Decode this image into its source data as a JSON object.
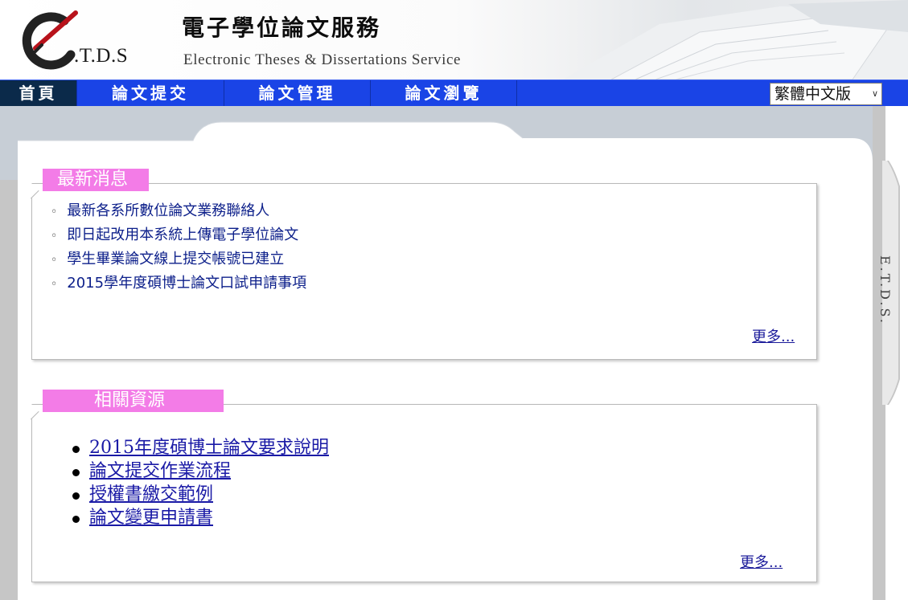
{
  "header": {
    "logo_text": ".T.D.S",
    "title_zh": "電子學位論文服務",
    "title_en": "Electronic Theses & Dissertations Service"
  },
  "nav": {
    "items": [
      {
        "label": "首頁"
      },
      {
        "label": "論文提交"
      },
      {
        "label": "論文管理"
      },
      {
        "label": "論文瀏覽"
      }
    ],
    "language_selected": "繁體中文版"
  },
  "side_tab": {
    "label": "E.T.D.S."
  },
  "news": {
    "heading": "最新消息",
    "items": [
      "最新各系所數位論文業務聯絡人",
      "即日起改用本系統上傳電子學位論文",
      "學生畢業論文線上提交帳號已建立",
      "2015學年度碩博士論文口試申請事項"
    ],
    "more": "更多..."
  },
  "resources": {
    "heading": "相關資源",
    "items": [
      "2015年度碩博士論文要求說明",
      "論文提交作業流程",
      "授權書繳交範例",
      "論文變更申請書"
    ],
    "more": "更多..."
  },
  "colors": {
    "nav_bg": "#1a44e6",
    "nav_active_bg": "#0b2a4a",
    "label_pink": "#f37ce7",
    "link_blue": "#1a1aa6"
  }
}
